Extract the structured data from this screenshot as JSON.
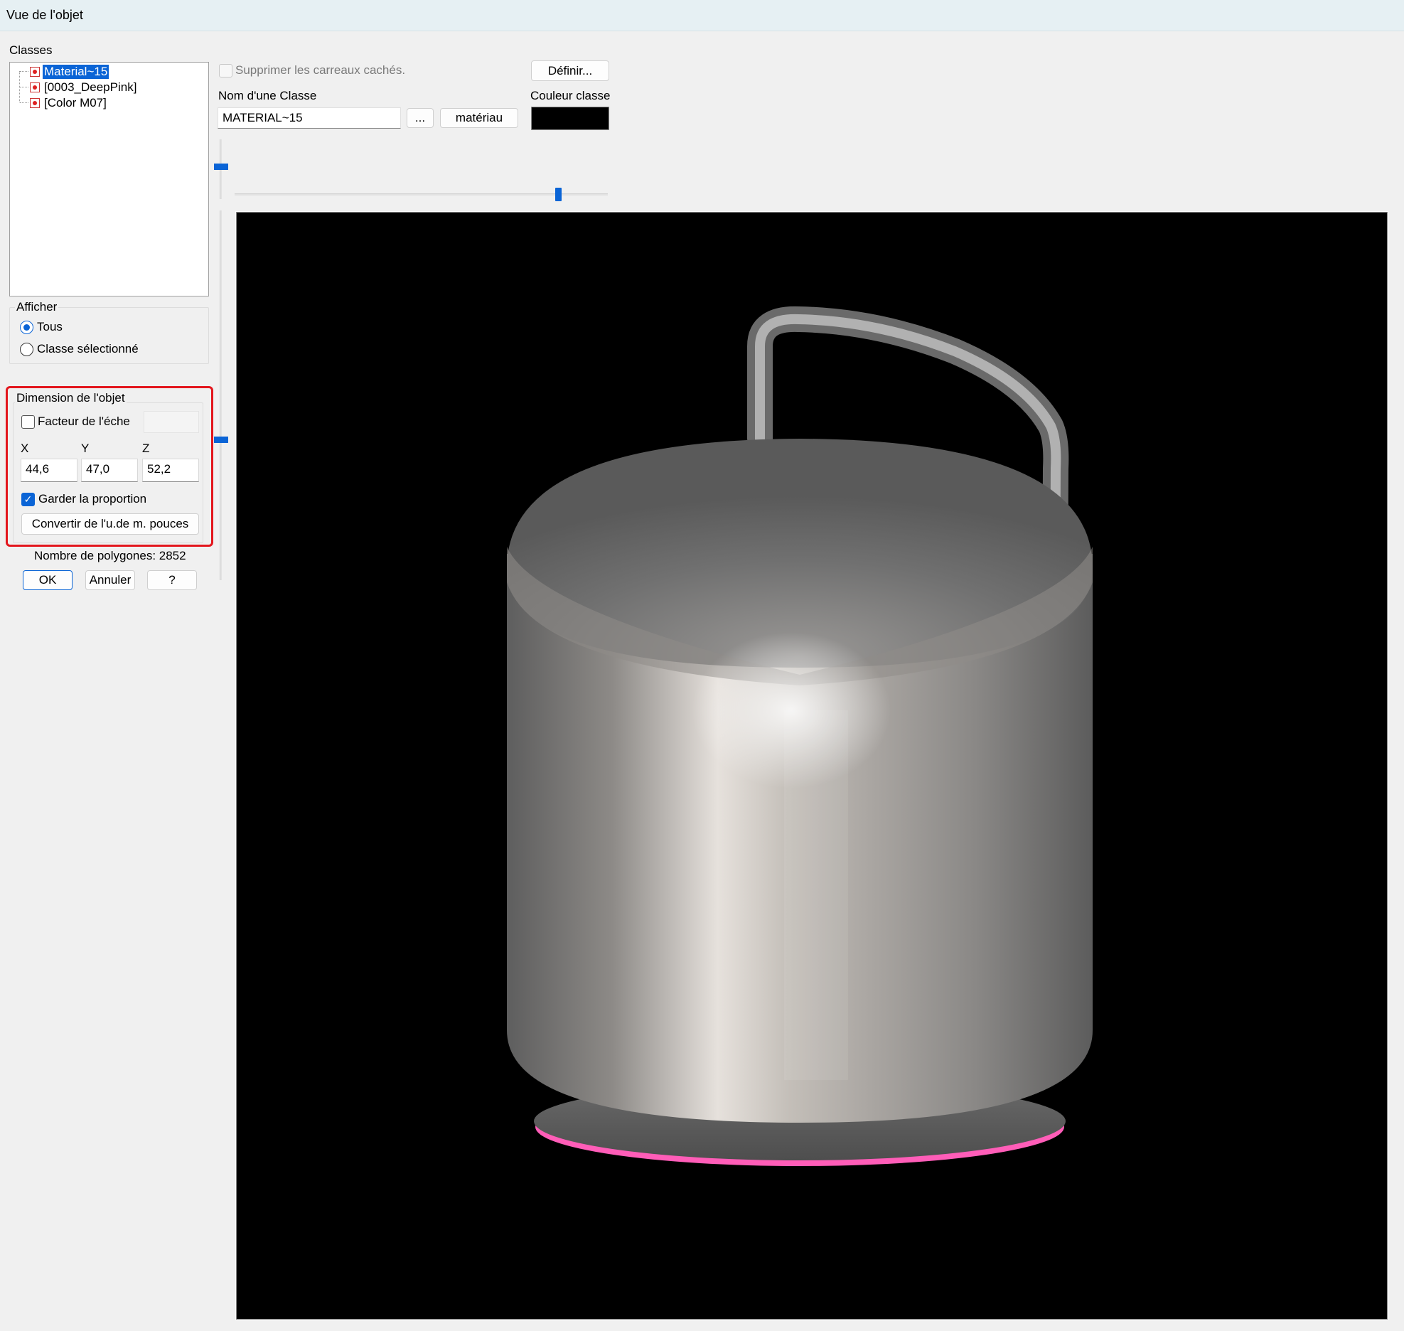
{
  "window": {
    "title": "Vue de l'objet"
  },
  "classes": {
    "label": "Classes",
    "items": [
      {
        "label": "Material~15",
        "selected": true
      },
      {
        "label": "[0003_DeepPink]",
        "selected": false
      },
      {
        "label": "[Color M07]",
        "selected": false
      }
    ]
  },
  "afficher": {
    "label": "Afficher",
    "options": [
      {
        "label": "Tous",
        "checked": true
      },
      {
        "label": "Classe sélectionné",
        "checked": false
      }
    ]
  },
  "dimension": {
    "label": "Dimension de l'objet",
    "scale_label": "Facteur de l'échelle",
    "scale_checked": false,
    "scale_value": "",
    "x_label": "X",
    "y_label": "Y",
    "z_label": "Z",
    "x_value": "44,6",
    "y_value": "47,0",
    "z_value": "52,2",
    "keep_ratio_label": "Garder la proportion",
    "keep_ratio_checked": true,
    "convert_label": "Convertir de l'u.de m. pouces"
  },
  "polygons": {
    "text": "Nombre de polygones: 2852"
  },
  "buttons": {
    "ok": "OK",
    "cancel": "Annuler",
    "help": "?"
  },
  "top": {
    "hide_tiles_label": "Supprimer les carreaux cachés.",
    "hide_tiles_checked": false,
    "define_label": "Définir...",
    "class_name_label": "Nom d'une Classe",
    "class_name_value": "MATERIAL~15",
    "browse_label": "...",
    "material_label": "matériau",
    "class_color_label": "Couleur classe",
    "class_color": "#000000"
  },
  "colors": {
    "accent": "#0a64d6",
    "highlight_box": "#e3161d",
    "viewport_bg": "#000000",
    "object_base_accent": "#ff5db8"
  },
  "viewport": {
    "object": "stainless-steel-tank-with-pipe"
  }
}
